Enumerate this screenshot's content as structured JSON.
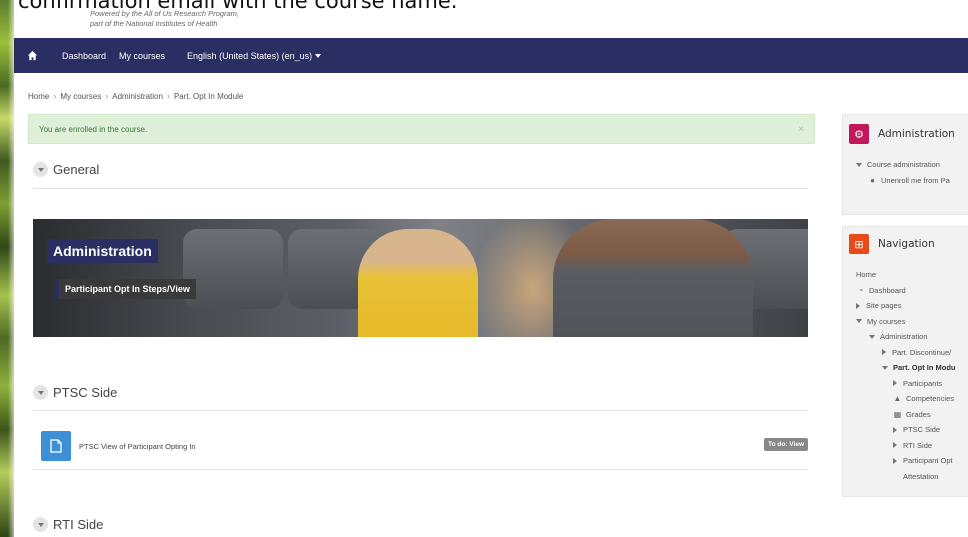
{
  "caption": {
    "text": "confirmation email with the course name."
  },
  "branding": {
    "line1": "Powered by the All of Us Research Program,",
    "line2": "part of the National Institutes of Health"
  },
  "navbar": {
    "links": [
      "Dashboard",
      "My courses",
      "English (United States) (en_us)"
    ]
  },
  "breadcrumb": [
    "Home",
    "My courses",
    "Administration",
    "Part. Opt In Module"
  ],
  "alert": {
    "message": "You are enrolled in the course.",
    "close": "×"
  },
  "sections": {
    "general": "General",
    "ptsc": "PTSC Side",
    "rti": "RTI Side"
  },
  "banner": {
    "title": "Administration",
    "subtitle": "Participant Opt In Steps/View"
  },
  "activity": {
    "name": "PTSC View of Participant Opting In",
    "badge": "To do: View"
  },
  "admin_block": {
    "title": "Administration",
    "items": [
      "Course administration",
      "Unenroll me from Pa"
    ]
  },
  "nav_block": {
    "title": "Navigation",
    "home": "Home",
    "dashboard": "Dashboard",
    "site_pages": "Site pages",
    "my_courses": "My courses",
    "administration": "Administration",
    "discontinue": "Part. Discontinue/",
    "opt_in": "Part. Opt In Modu",
    "participants": "Participants",
    "competencies": "Competencies",
    "grades": "Grades",
    "ptsc_side": "PTSC Side",
    "rti_side": "RTI Side",
    "participant_opt": "Participant Opt",
    "attestation": "Attestation"
  },
  "colors": {
    "navbar": "#2a2e63",
    "alert_bg": "#dff0d8",
    "admin_icon": "#c2185b",
    "nav_icon": "#e64a19",
    "activity_icon": "#3d8fd6"
  }
}
